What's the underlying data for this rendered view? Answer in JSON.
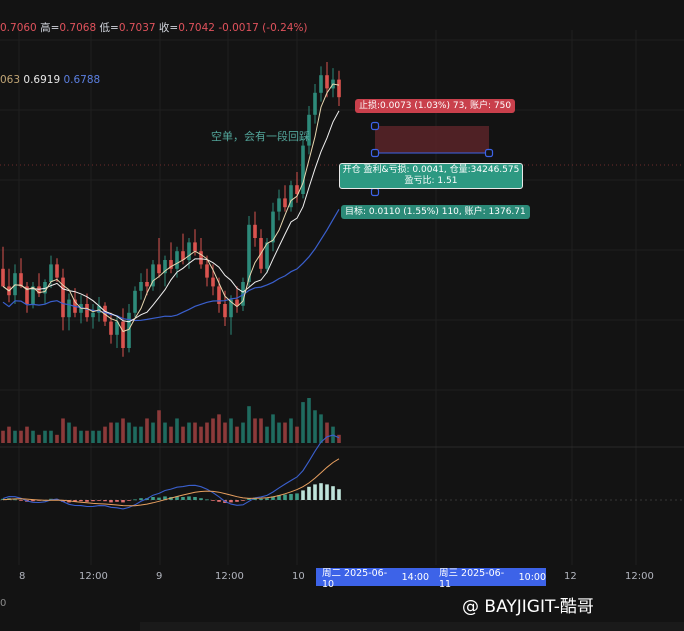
{
  "ohlc": {
    "open_value": "0.7060",
    "high_label": "高=",
    "high_value": "0.7068",
    "low_label": "低=",
    "low_value": "0.7037",
    "close_label": "收=",
    "close_value": "0.7042",
    "change": "-0.0017 (-0.24%)"
  },
  "ma": {
    "ma1": "063",
    "ma2": "0.6919",
    "ma3": "0.6788"
  },
  "annotation": "空单，会有一段回踩",
  "stop_label": "止损:0.0073 (1.03%) 73, 账户: 750",
  "position_line1": "开仓 盈利&亏损: 0.0041, 仓量:34246.575",
  "position_line2": "盈亏比: 1.51",
  "target_label": "目标: 0.0110 (1.55%) 110, 账户: 1376.71",
  "time_axis": {
    "ticks": [
      "8",
      "12:00",
      "9",
      "12:00",
      "10",
      "12",
      "12:00"
    ],
    "hl_left": "周二 2025-06-10",
    "hl_left_time": "14:00",
    "hl_right": "周三 2025-06-11",
    "hl_right_time": "10:00"
  },
  "watermark": "@ BAYJIGIT-酷哥",
  "corner": "0",
  "colors": {
    "up": "#2d8a7a",
    "down": "#d9534f",
    "ma_fast": "#e8d7b0",
    "ma_mid": "#f0f0f0",
    "ma_slow": "#3a5fcd",
    "macd_line": "#3a5fcd",
    "signal_line": "#e8a060"
  },
  "chart_data": {
    "type": "candlestick",
    "candles": [
      [
        0.69,
        0.6925,
        0.688,
        0.688
      ],
      [
        0.688,
        0.69,
        0.6862,
        0.687
      ],
      [
        0.687,
        0.6905,
        0.686,
        0.6895
      ],
      [
        0.6895,
        0.6912,
        0.6878,
        0.688
      ],
      [
        0.688,
        0.6885,
        0.685,
        0.686
      ],
      [
        0.686,
        0.6885,
        0.6855,
        0.688
      ],
      [
        0.688,
        0.6895,
        0.6868,
        0.6872
      ],
      [
        0.6872,
        0.6888,
        0.686,
        0.6885
      ],
      [
        0.6885,
        0.6915,
        0.6878,
        0.6905
      ],
      [
        0.6905,
        0.6912,
        0.6885,
        0.689
      ],
      [
        0.689,
        0.69,
        0.683,
        0.6845
      ],
      [
        0.6845,
        0.6872,
        0.683,
        0.6865
      ],
      [
        0.6865,
        0.6878,
        0.6845,
        0.685
      ],
      [
        0.685,
        0.687,
        0.6838,
        0.686
      ],
      [
        0.686,
        0.6872,
        0.684,
        0.6845
      ],
      [
        0.6845,
        0.686,
        0.6832,
        0.685
      ],
      [
        0.685,
        0.6868,
        0.684,
        0.6858
      ],
      [
        0.6858,
        0.6862,
        0.6835,
        0.684
      ],
      [
        0.684,
        0.685,
        0.6815,
        0.6825
      ],
      [
        0.6825,
        0.6845,
        0.681,
        0.684
      ],
      [
        0.684,
        0.6855,
        0.68,
        0.681
      ],
      [
        0.681,
        0.686,
        0.6805,
        0.685
      ],
      [
        0.685,
        0.688,
        0.6845,
        0.6875
      ],
      [
        0.6875,
        0.6895,
        0.6865,
        0.6885
      ],
      [
        0.6885,
        0.69,
        0.687,
        0.688
      ],
      [
        0.688,
        0.691,
        0.6875,
        0.6905
      ],
      [
        0.6905,
        0.6935,
        0.689,
        0.6895
      ],
      [
        0.6895,
        0.6915,
        0.688,
        0.691
      ],
      [
        0.691,
        0.693,
        0.6895,
        0.69
      ],
      [
        0.69,
        0.6925,
        0.689,
        0.692
      ],
      [
        0.692,
        0.694,
        0.6905,
        0.691
      ],
      [
        0.691,
        0.6935,
        0.69,
        0.693
      ],
      [
        0.693,
        0.6945,
        0.6915,
        0.692
      ],
      [
        0.692,
        0.6935,
        0.69,
        0.6905
      ],
      [
        0.6905,
        0.6915,
        0.688,
        0.689
      ],
      [
        0.689,
        0.6905,
        0.687,
        0.688
      ],
      [
        0.688,
        0.689,
        0.685,
        0.686
      ],
      [
        0.686,
        0.6875,
        0.6835,
        0.6845
      ],
      [
        0.6845,
        0.687,
        0.6825,
        0.6865
      ],
      [
        0.6865,
        0.688,
        0.685,
        0.6858
      ],
      [
        0.6858,
        0.689,
        0.6852,
        0.6885
      ],
      [
        0.6885,
        0.696,
        0.688,
        0.695
      ],
      [
        0.695,
        0.6965,
        0.6925,
        0.6935
      ],
      [
        0.6935,
        0.6945,
        0.6895,
        0.69
      ],
      [
        0.69,
        0.6935,
        0.6895,
        0.693
      ],
      [
        0.693,
        0.6975,
        0.692,
        0.6965
      ],
      [
        0.6965,
        0.699,
        0.6955,
        0.698
      ],
      [
        0.698,
        0.6995,
        0.6965,
        0.697
      ],
      [
        0.697,
        0.7,
        0.6965,
        0.6995
      ],
      [
        0.6995,
        0.701,
        0.6975,
        0.6985
      ],
      [
        0.6985,
        0.705,
        0.698,
        0.704
      ],
      [
        0.704,
        0.7085,
        0.703,
        0.7075
      ],
      [
        0.7075,
        0.711,
        0.7065,
        0.71
      ],
      [
        0.71,
        0.713,
        0.709,
        0.712
      ],
      [
        0.712,
        0.7135,
        0.7095,
        0.7105
      ],
      [
        0.7105,
        0.7128,
        0.7095,
        0.7115
      ],
      [
        0.7115,
        0.7125,
        0.7085,
        0.7095
      ]
    ],
    "volumes": [
      3,
      4,
      3,
      3,
      4,
      3,
      2,
      3,
      3,
      2,
      6,
      5,
      4,
      3,
      3,
      3,
      3,
      4,
      5,
      5,
      6,
      5,
      4,
      4,
      6,
      5,
      8,
      5,
      4,
      6,
      4,
      5,
      5,
      4,
      5,
      6,
      7,
      5,
      6,
      4,
      5,
      9,
      6,
      6,
      4,
      7,
      5,
      5,
      6,
      4,
      10,
      11,
      8,
      7,
      5,
      4,
      2
    ],
    "macd_hist": [
      0.2,
      0.3,
      0.1,
      -0.1,
      -0.3,
      -0.2,
      -0.1,
      0.0,
      0.2,
      0.1,
      -0.3,
      -0.4,
      -0.3,
      -0.2,
      -0.3,
      -0.2,
      -0.1,
      -0.2,
      -0.4,
      -0.3,
      -0.4,
      -0.1,
      0.1,
      0.3,
      0.3,
      0.5,
      0.4,
      0.6,
      0.5,
      0.6,
      0.5,
      0.6,
      0.5,
      0.3,
      0.1,
      -0.1,
      -0.3,
      -0.5,
      -0.4,
      -0.3,
      -0.1,
      0.3,
      0.4,
      0.2,
      0.3,
      0.6,
      0.8,
      0.9,
      1.0,
      1.1,
      1.6,
      2.2,
      2.6,
      2.8,
      2.6,
      2.3,
      1.8
    ],
    "price_range": [
      0.6785,
      0.716
    ],
    "position": {
      "entry": 0.7095,
      "stop": 0.7168,
      "target": 0.6985
    }
  }
}
